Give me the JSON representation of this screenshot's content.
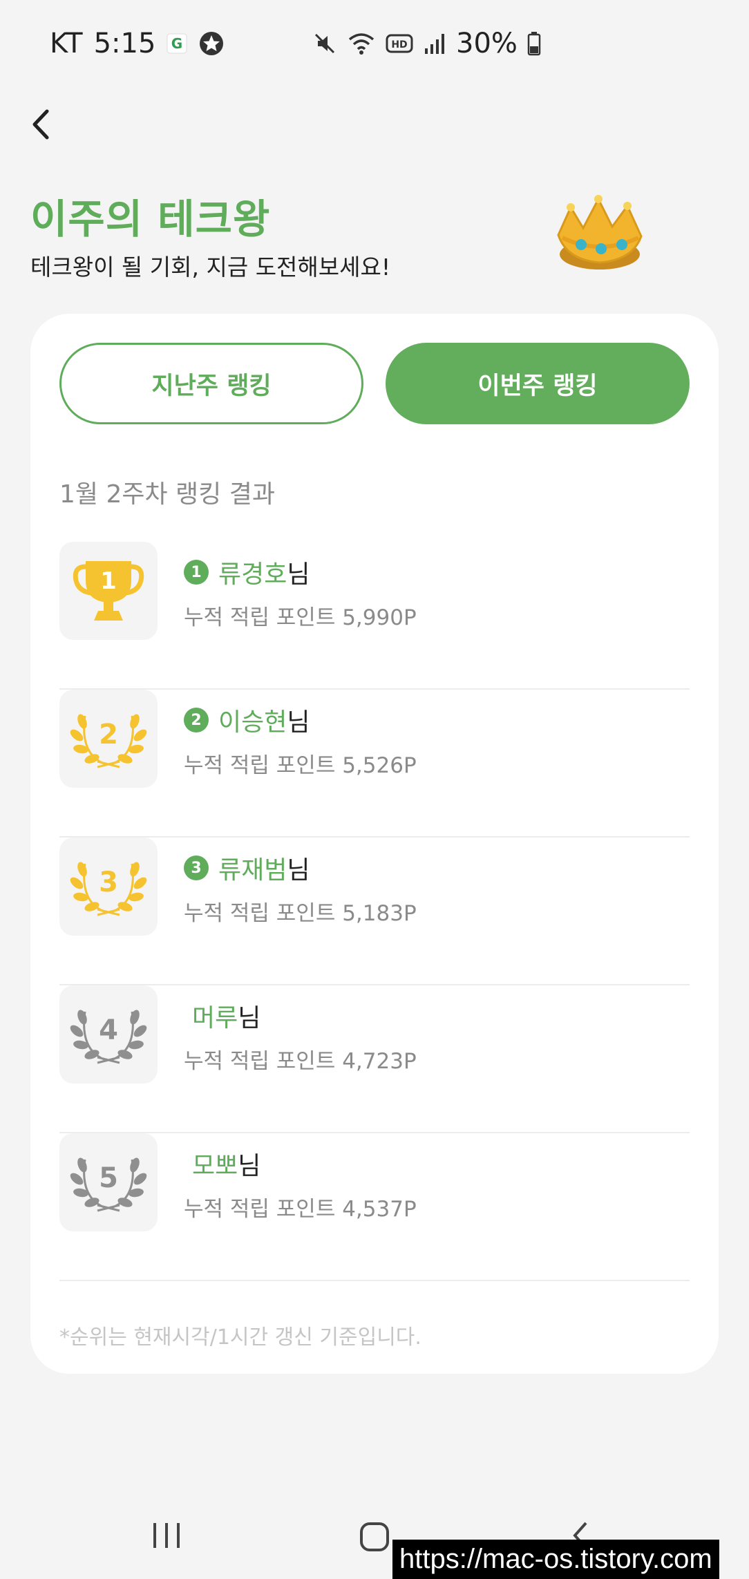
{
  "status_bar": {
    "carrier": "KT",
    "time": "5:15",
    "battery": "30%",
    "icons_left": [
      "g-app-icon",
      "star-app-icon"
    ],
    "icons_right": [
      "mute-icon",
      "wifi-icon",
      "hd-icon",
      "signal-icon",
      "battery-icon"
    ]
  },
  "header": {
    "title": "이주의 테크왕",
    "subtitle": "테크왕이 될 기회, 지금 도전해보세요!"
  },
  "tabs": {
    "last_week": "지난주 랭킹",
    "this_week": "이번주 랭킹",
    "selected": "this_week"
  },
  "ranking": {
    "week_title": "1월 2주차 랭킹 결과",
    "items": [
      {
        "rank": "1",
        "name": "류경호",
        "suffix": "님",
        "points": "누적 적립 포인트 5,990P"
      },
      {
        "rank": "2",
        "name": "이승현",
        "suffix": "님",
        "points": "누적 적립 포인트 5,526P"
      },
      {
        "rank": "3",
        "name": "류재범",
        "suffix": "님",
        "points": "누적 적립 포인트 5,183P"
      },
      {
        "rank": "4",
        "name": "머루",
        "suffix": "님",
        "points": "누적 적립 포인트 4,723P"
      },
      {
        "rank": "5",
        "name": "모뽀",
        "suffix": "님",
        "points": "누적 적립 포인트 4,537P"
      }
    ]
  },
  "footnote": "*순위는 현재시각/1시간 갱신 기준입니다.",
  "watermark": "https://mac-os.tistory.com",
  "colors": {
    "accent": "#5fac5b",
    "gold": "#f6c330",
    "silver": "#8f8f8f"
  }
}
